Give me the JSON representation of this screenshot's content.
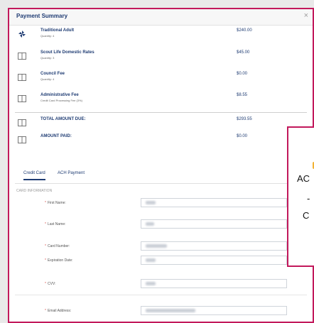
{
  "modal": {
    "title": "Payment Summary",
    "close_glyph": "×"
  },
  "items": [
    {
      "name": "Traditional Adult",
      "sub": "Quantity: 4",
      "amount": "$240.00",
      "icon": "pinwheel-icon"
    },
    {
      "name": "Scout Life Domestic Rates",
      "sub": "Quantity: 3",
      "amount": "$45.00",
      "icon": "book-icon"
    },
    {
      "name": "Council Fee",
      "sub": "Quantity: 4",
      "amount": "$0.00",
      "icon": "book-icon"
    },
    {
      "name": "Administrative Fee",
      "sub": "Credit Card Processing Fee (3%)",
      "amount": "$8.55",
      "icon": "book-icon"
    }
  ],
  "totals": [
    {
      "name": "TOTAL AMOUNT DUE:",
      "amount": "$293.55",
      "icon": "book-icon"
    },
    {
      "name": "AMOUNT PAID:",
      "amount": "$0.00",
      "icon": "book-icon"
    }
  ],
  "tabs": {
    "credit_card": "Credit Card",
    "ach": "ACH Payment"
  },
  "section_title": "CARD INFORMATION",
  "fields": [
    {
      "label": "First Name:"
    },
    {
      "label": "Last Name:"
    },
    {
      "label": "Card Number:"
    },
    {
      "label": "Expiration Date:"
    },
    {
      "label": "CVV:"
    },
    {
      "label": "Email Address:"
    }
  ],
  "popup": {
    "line1": "AC",
    "line2": "-",
    "line3": "C"
  },
  "colors": {
    "accent": "#c2185b",
    "brand": "#1f3c73"
  }
}
